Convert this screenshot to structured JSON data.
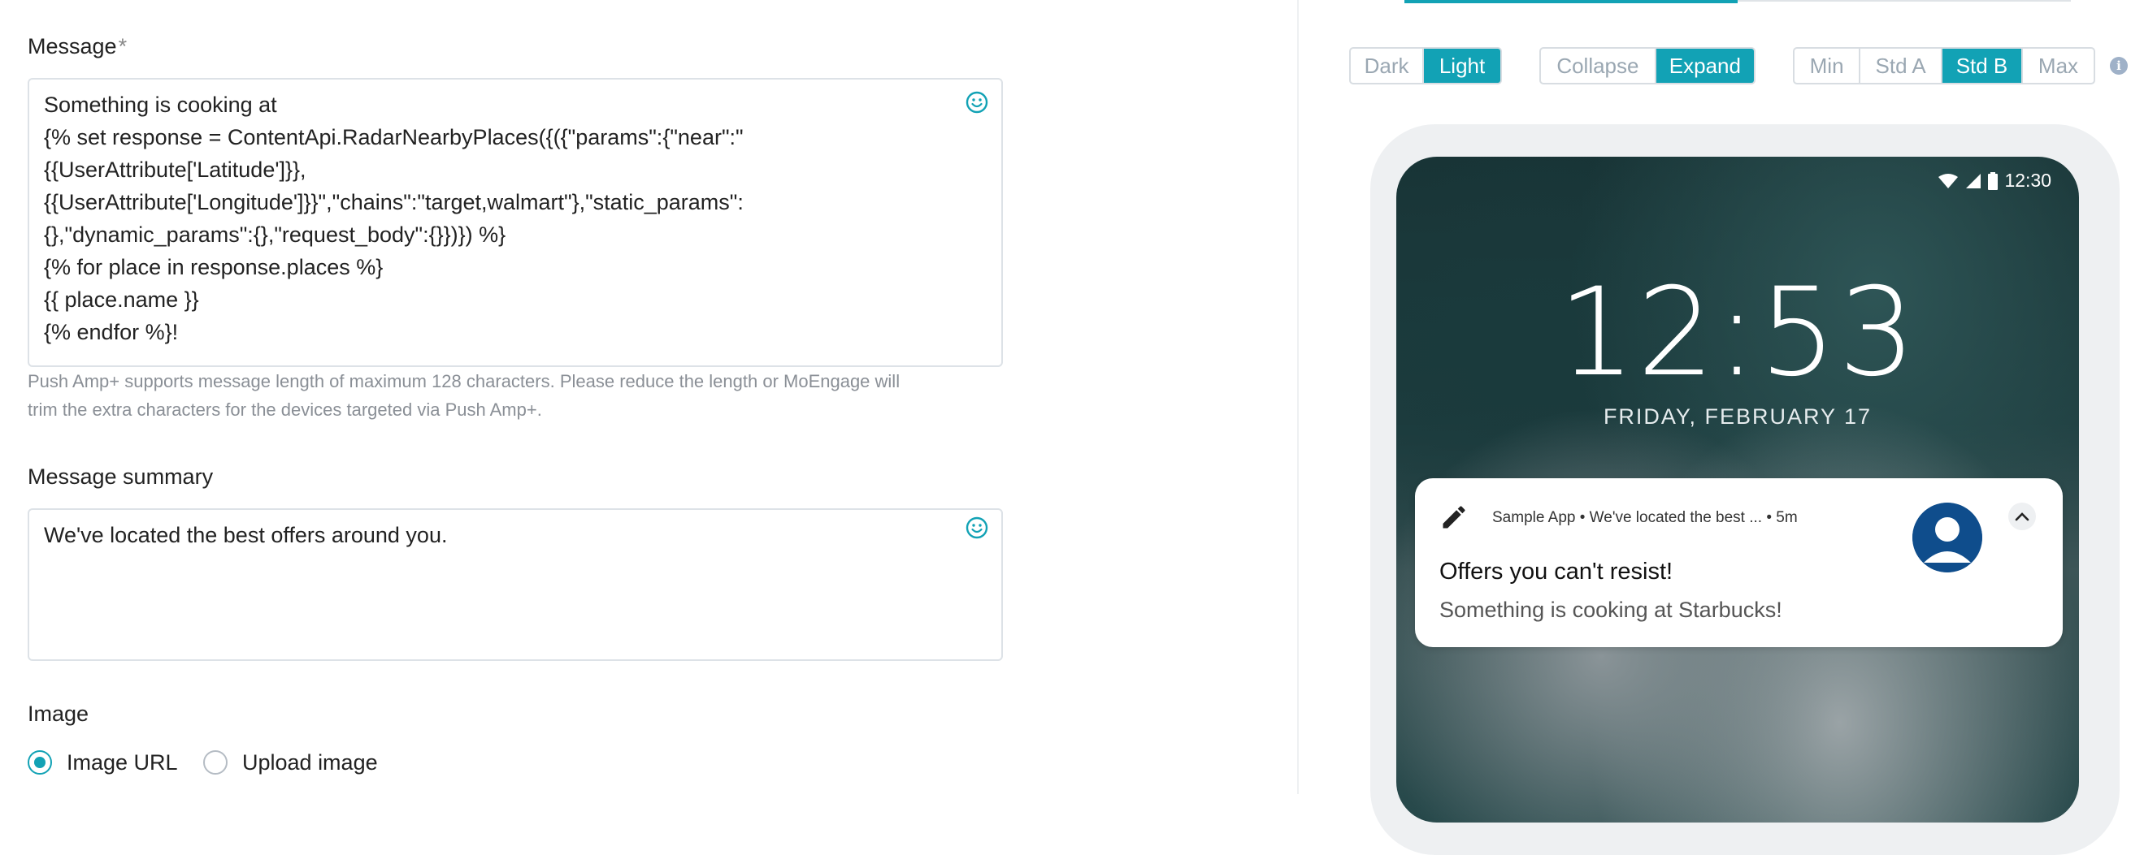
{
  "form": {
    "message_label": "Message",
    "message_required": "*",
    "message_lines": [
      "Something is cooking at",
      "{% set response = ContentApi.RadarNearbyPlaces({({\"params\":{\"near\":\"",
      "{{UserAttribute['Latitude']}},",
      "{{UserAttribute['Longitude']}}\",\"chains\":\"target,walmart\"},\"static_params\":",
      "{},\"dynamic_params\":{},\"request_body\":{}})}) %}",
      "{% for place in response.places %}",
      "{{ place.name }}",
      "{% endfor %}!"
    ],
    "message_hint_lines": [
      "Push Amp+ supports message length of maximum 128 characters. Please reduce the length or MoEngage will",
      "trim the extra characters for the devices targeted via Push Amp+."
    ],
    "summary_label": "Message summary",
    "summary_value": "We've located the best offers around you.",
    "image_label": "Image",
    "image_options": [
      {
        "label": "Image URL",
        "selected": true
      },
      {
        "label": "Upload image",
        "selected": false
      }
    ]
  },
  "preview": {
    "theme_options": [
      "Dark",
      "Light"
    ],
    "theme_selected": "Light",
    "layout_options": [
      "Collapse",
      "Expand"
    ],
    "layout_selected": "Expand",
    "size_options": [
      "Min",
      "Std A",
      "Std B",
      "Max"
    ],
    "size_selected": "Std B",
    "status_time": "12:30",
    "lock_time": "12:53",
    "lock_date": "FRIDAY, FEBRUARY 17",
    "notification": {
      "meta": "Sample App • We've located the best ...  • 5m",
      "title": "Offers you can't resist!",
      "body": "Something is cooking at Starbucks!"
    }
  },
  "colors": {
    "accent": "#12a2b5",
    "inactive_text": "#9aa7b2",
    "border": "#dde2e7"
  }
}
